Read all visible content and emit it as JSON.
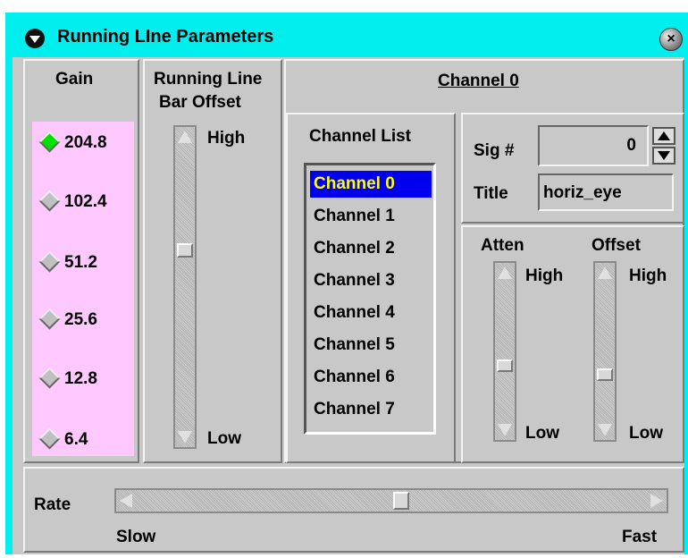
{
  "window": {
    "title": "Running LIne Parameters"
  },
  "gain": {
    "label": "Gain",
    "options": [
      {
        "label": "204.8",
        "selected": true
      },
      {
        "label": "102.4",
        "selected": false
      },
      {
        "label": "51.2",
        "selected": false
      },
      {
        "label": "25.6",
        "selected": false
      },
      {
        "label": "12.8",
        "selected": false
      },
      {
        "label": "6.4",
        "selected": false
      }
    ]
  },
  "bar_offset": {
    "label_line1": "Running Line",
    "label_line2": "Bar Offset",
    "high": "High",
    "low": "Low"
  },
  "channel": {
    "heading": "Channel 0",
    "list_label": "Channel List",
    "items": [
      "Channel 0",
      "Channel 1",
      "Channel 2",
      "Channel 3",
      "Channel 4",
      "Channel 5",
      "Channel 6",
      "Channel 7"
    ],
    "selected": "Channel 0"
  },
  "signal": {
    "sig_label": "Sig #",
    "sig_value": "0",
    "title_label": "Title",
    "title_value": "horiz_eye"
  },
  "atten": {
    "label": "Atten",
    "high": "High",
    "low": "Low"
  },
  "offset": {
    "label": "Offset",
    "high": "High",
    "low": "Low"
  },
  "rate": {
    "label": "Rate",
    "slow": "Slow",
    "fast": "Fast"
  },
  "colors": {
    "titlebar": "#00eeee",
    "gain_bg": "#ffc8ff",
    "selected_item": "#0000ee",
    "selected_text": "#ffff00",
    "radio_on": "#00e000"
  }
}
